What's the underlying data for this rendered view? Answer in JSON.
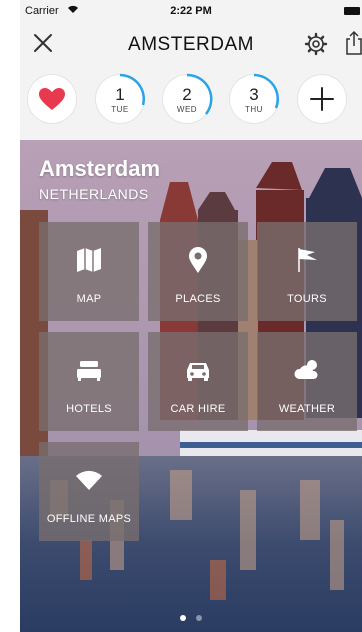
{
  "status_bar": {
    "carrier": "Carrier",
    "time": "2:22 PM"
  },
  "nav": {
    "title": "AMSTERDAM"
  },
  "days": [
    {
      "num": "1",
      "dow": "TUE"
    },
    {
      "num": "2",
      "dow": "WED"
    },
    {
      "num": "3",
      "dow": "THU"
    }
  ],
  "hero": {
    "city": "Amsterdam",
    "country": "NETHERLANDS"
  },
  "tiles": [
    {
      "label": "MAP",
      "icon": "map-icon"
    },
    {
      "label": "PLACES",
      "icon": "pin-icon"
    },
    {
      "label": "TOURS",
      "icon": "flag-icon"
    },
    {
      "label": "HOTELS",
      "icon": "bed-icon"
    },
    {
      "label": "CAR HIRE",
      "icon": "car-icon"
    },
    {
      "label": "WEATHER",
      "icon": "weather-icon"
    },
    {
      "label": "OFFLINE MAPS",
      "icon": "wifi-icon"
    }
  ],
  "pager": {
    "pages": 2,
    "current": 1
  },
  "colors": {
    "accent": "#2aa3e8",
    "heart": "#e8394f"
  }
}
